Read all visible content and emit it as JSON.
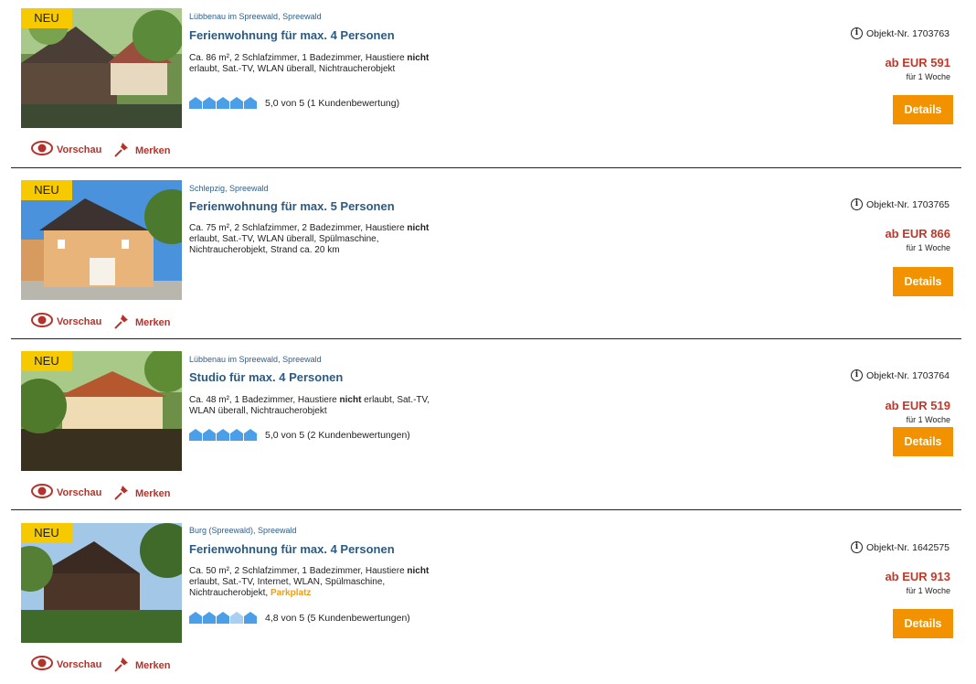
{
  "listings": [
    {
      "badge": "NEU",
      "location": "Lübbenau im Spreewald, Spreewald",
      "title": "Ferienwohnung für max. 4 Personen",
      "desc_pre": "Ca. 86 m², 2 Schlafzimmer, 1 Badezimmer, Haustiere",
      "desc_bold": "nicht",
      "desc_post": " erlaubt, Sat.-TV, WLAN überall, Nichtraucherobjekt",
      "desc_extra": "",
      "rating_stars": 5,
      "rating_text": "5,0 von 5 (1 Kundenbewertung)",
      "object_nr": "Objekt-Nr. 1703763",
      "price": "ab EUR 591",
      "period": "für 1 Woche",
      "details_label": "Details",
      "preview_label": "Vorschau",
      "bookmark_label": "Merken"
    },
    {
      "badge": "NEU",
      "location": "Schlepzig, Spreewald",
      "title": "Ferienwohnung für max. 5 Personen",
      "desc_pre": "Ca. 75 m², 2 Schlafzimmer, 2 Badezimmer, Haustiere",
      "desc_bold": "nicht",
      "desc_post": " erlaubt, Sat.-TV, WLAN überall, Spülmaschine, Nichtraucherobjekt, Strand ca. 20 km",
      "desc_extra": "",
      "rating_stars": 0,
      "rating_text": "",
      "object_nr": "Objekt-Nr. 1703765",
      "price": "ab EUR 866",
      "period": "für 1 Woche",
      "details_label": "Details",
      "preview_label": "Vorschau",
      "bookmark_label": "Merken"
    },
    {
      "badge": "NEU",
      "location": "Lübbenau im Spreewald, Spreewald",
      "title": "Studio für max. 4 Personen",
      "desc_pre": "Ca. 48 m², 1 Badezimmer, Haustiere",
      "desc_bold": "nicht",
      "desc_post": " erlaubt, Sat.-TV, WLAN überall, Nichtraucherobjekt",
      "desc_extra": "",
      "rating_stars": 5,
      "rating_text": "5,0 von 5 (2 Kundenbewertungen)",
      "object_nr": "Objekt-Nr. 1703764",
      "price": "ab EUR 519",
      "period": "für 1 Woche",
      "details_label": "Details",
      "preview_label": "Vorschau",
      "bookmark_label": "Merken"
    },
    {
      "badge": "NEU",
      "location": "Burg (Spreewald), Spreewald",
      "title": "Ferienwohnung für max. 4 Personen",
      "desc_pre": "Ca. 50 m², 2 Schlafzimmer, 1 Badezimmer, Haustiere",
      "desc_bold": "nicht",
      "desc_post": " erlaubt, Sat.-TV, Internet, WLAN, Spülmaschine, Nichtraucherobjekt, ",
      "desc_extra": "Parkplatz",
      "rating_stars": 4.8,
      "rating_text": "4,8 von 5 (5 Kundenbewertungen)",
      "object_nr": "Objekt-Nr. 1642575",
      "price": "ab EUR 913",
      "period": "für 1 Woche",
      "details_label": "Details",
      "preview_label": "Vorschau",
      "bookmark_label": "Merken"
    }
  ],
  "colors": {
    "accent_orange": "#f39200",
    "price_red": "#c0392b",
    "title_blue": "#2c5a82",
    "badge_yellow": "#f6c900",
    "rating_blue": "#4a9fe8"
  },
  "icons": [
    "eye-icon",
    "pin-icon",
    "info-icon",
    "house-rating-icon"
  ]
}
